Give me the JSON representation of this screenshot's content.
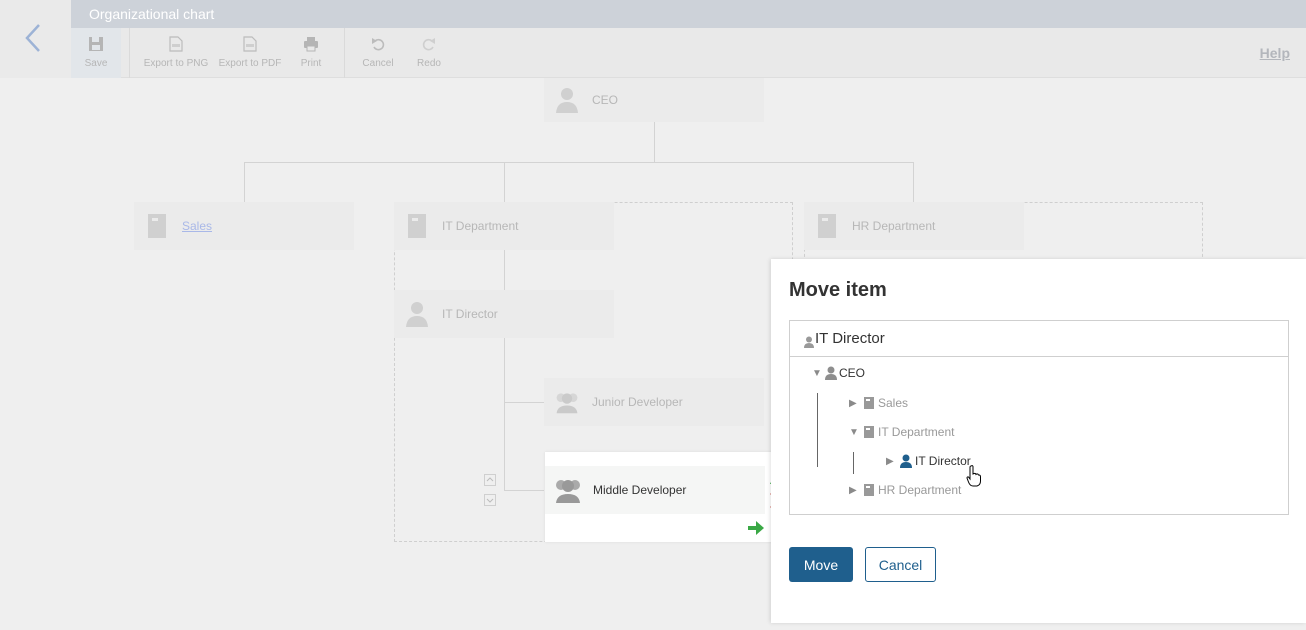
{
  "header": {
    "title": "Organizational chart",
    "help_label": "Help"
  },
  "toolbar": {
    "save": "Save",
    "export_png": "Export to PNG",
    "export_pdf": "Export to PDF",
    "print": "Print",
    "cancel": "Cancel",
    "redo": "Redo"
  },
  "chart": {
    "ceo": "CEO",
    "sales": "Sales",
    "it_department": "IT Department",
    "hr_department": "HR Department",
    "it_director": "IT Director",
    "junior_developer": "Junior Developer",
    "middle_developer": "Middle Developer"
  },
  "modal": {
    "title": "Move item",
    "selected_value": "IT Director",
    "tree": {
      "ceo": "CEO",
      "sales": "Sales",
      "it_department": "IT Department",
      "it_director": "IT Director",
      "hr_department": "HR Department"
    },
    "move_label": "Move",
    "cancel_label": "Cancel"
  },
  "colors": {
    "primary": "#1f5f8d",
    "selected_icon": "#1f5f8d",
    "arrow_green": "#3aa845",
    "arrow_red": "#c0392b"
  }
}
